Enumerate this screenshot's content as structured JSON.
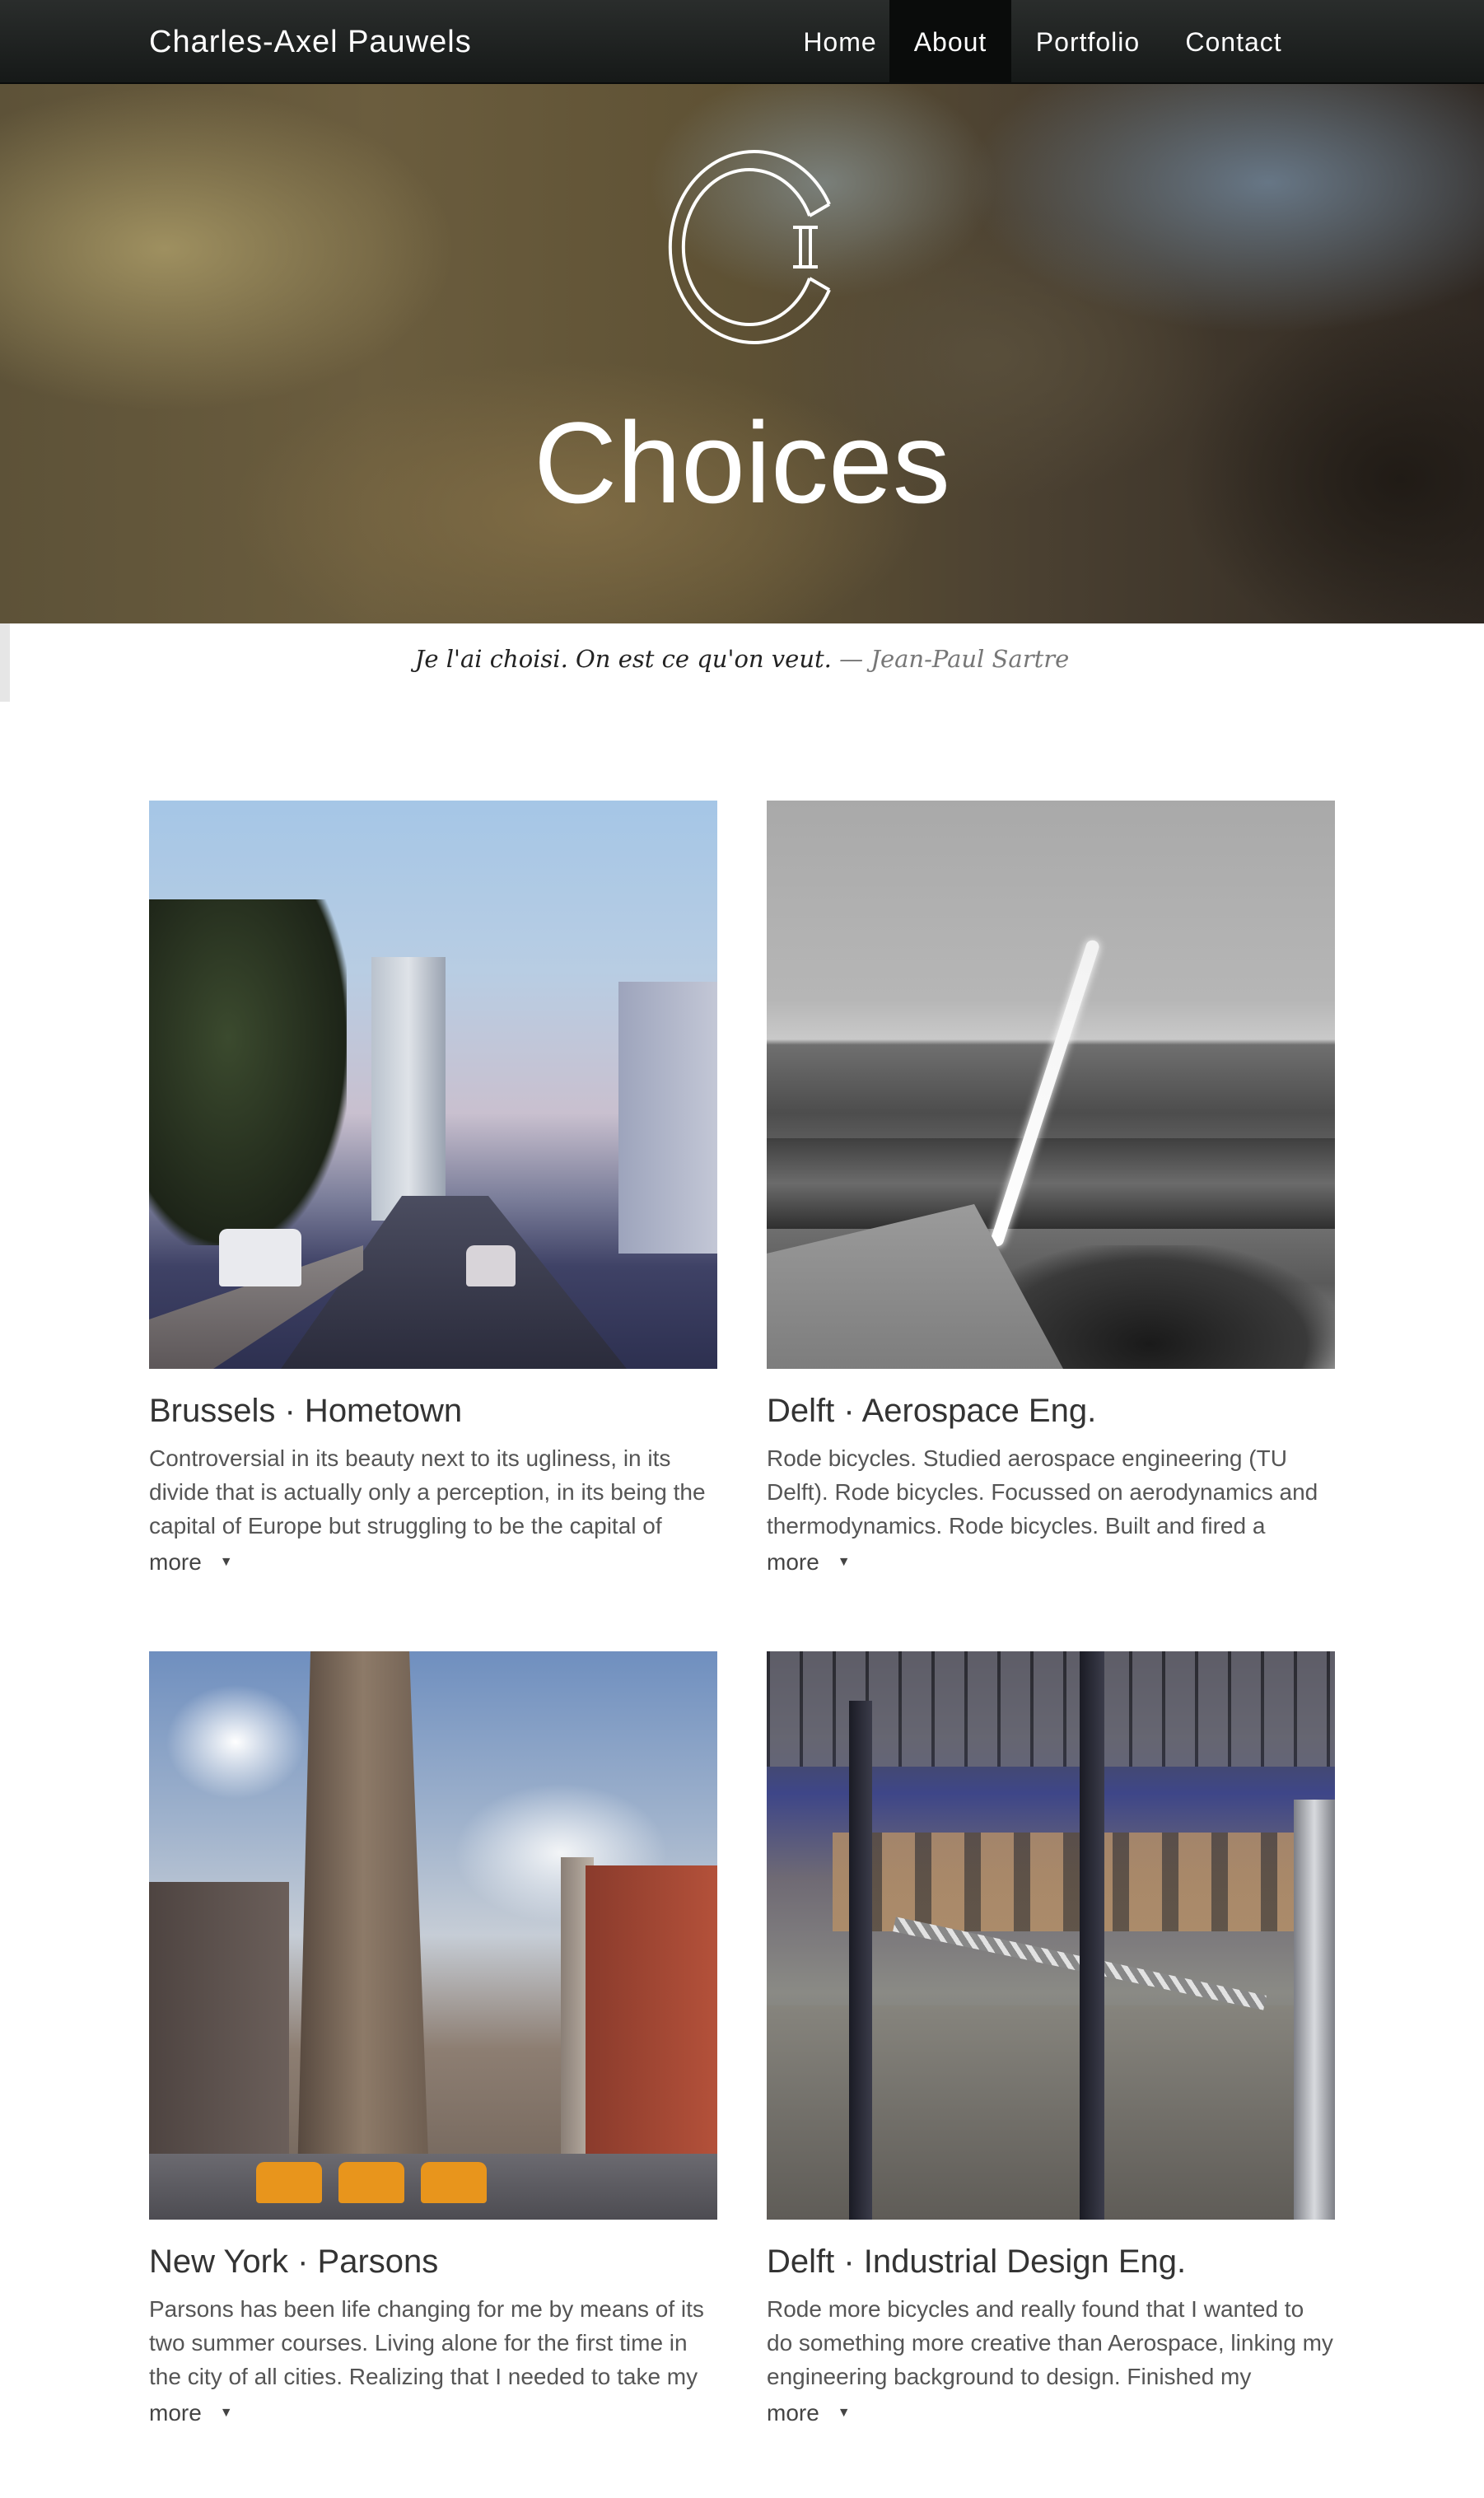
{
  "navbar": {
    "brand": "Charles-Axel Pauwels",
    "items": [
      {
        "label": "Home",
        "active": false
      },
      {
        "label": "About",
        "active": true
      },
      {
        "label": "Portfolio",
        "active": false
      },
      {
        "label": "Contact",
        "active": false
      }
    ]
  },
  "hero": {
    "logo_icon": "ci-monogram-icon",
    "title": "Choices"
  },
  "quote": {
    "text": "Je l'ai choisi. On est ce qu'on veut.",
    "author": "— Jean-Paul Sartre"
  },
  "cards": [
    {
      "title": "Brussels · Hometown",
      "text": "Controversial in its beauty next to its ugliness, in its divide that is actually only a perception, in its being the capital of Europe but struggling to be the capital of",
      "more": "more",
      "arrow": "▼"
    },
    {
      "title": "Delft · Aerospace Eng.",
      "text": "Rode bicycles. Studied aerospace engineering (TU Delft). Rode bicycles. Focussed on aerodynamics and thermodynamics. Rode bicycles. Built and fired a",
      "more": "more",
      "arrow": "▼"
    },
    {
      "title": "New York · Parsons",
      "text": "Parsons has been life changing for me by means of its two summer courses. Living alone for the first time in the city of all cities. Realizing that I needed to take my",
      "more": "more",
      "arrow": "▼"
    },
    {
      "title": "Delft · Industrial Design Eng.",
      "text": "Rode more bicycles and really found that I wanted to do something more creative than Aerospace, linking my engineering background to design. Finished my",
      "more": "more",
      "arrow": "▼"
    }
  ],
  "colors": {
    "navbar": "#1e2120",
    "nav_active": "#0a0c0b",
    "text": "#333333",
    "quote_author": "#777777"
  }
}
